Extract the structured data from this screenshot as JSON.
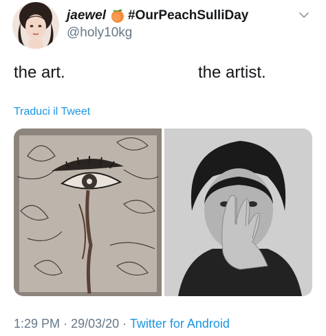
{
  "author": {
    "display_name": "jaewel",
    "hashtag": "#OurPeachSulliDay",
    "handle": "@holy10kg",
    "emoji_icon": "peach-icon"
  },
  "tweet": {
    "text_left": "the art.",
    "text_right": "the artist.",
    "translate_label": "Traduci il Tweet"
  },
  "media": {
    "left_image": "sketch-drawing-eye",
    "right_image": "portrait-hand-over-face"
  },
  "meta": {
    "time": "1:29 PM",
    "sep1": "·",
    "date": "29/03/20",
    "sep2": "·",
    "source": "Twitter for Android"
  },
  "colors": {
    "link": "#1b95e0",
    "secondary_text": "#657786",
    "primary_text": "#14171a"
  }
}
